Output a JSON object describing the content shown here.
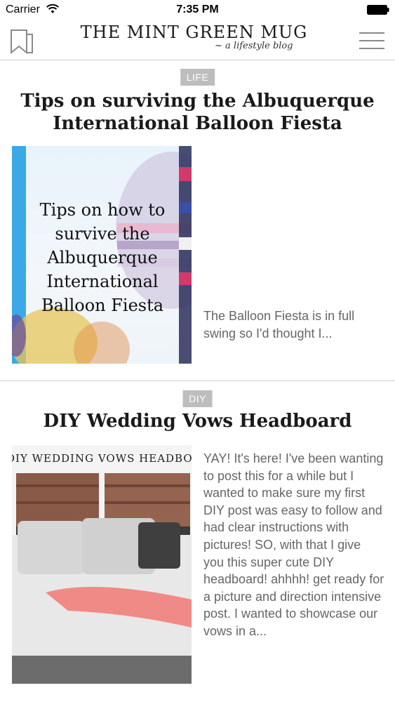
{
  "status": {
    "carrier": "Carrier",
    "time": "7:35 PM"
  },
  "header": {
    "brand_title": "THE MINT GREEN MUG",
    "brand_subtitle": "~ a lifestyle blog",
    "icons": [
      "bookmark-icon",
      "menu-icon"
    ]
  },
  "posts": [
    {
      "category": "LIFE",
      "title": "Tips on surviving the Albuquerque International Balloon Fiesta",
      "image_caption": "Tips on how to survive the Albuquerque International Balloon Fiesta",
      "excerpt": "The Balloon Fiesta is in full swing so I'd thought I..."
    },
    {
      "category": "DIY",
      "title": "DIY Wedding Vows Headboard",
      "image_caption": "DIY WEDDING VOWS HEADBOARD",
      "excerpt": "YAY! It's here! I've been wanting to post this for a while but I wanted to make sure my first DIY post was easy to follow and had clear instructions with pictures! SO, with that I give you this super cute DIY headboard! ahhhh! get ready for a picture and direction intensive post. I wanted to showcase our vows in a..."
    }
  ],
  "colors": {
    "badge": "#bdbdbd",
    "divider": "#cfcfcf",
    "excerpt_text": "#666666"
  }
}
